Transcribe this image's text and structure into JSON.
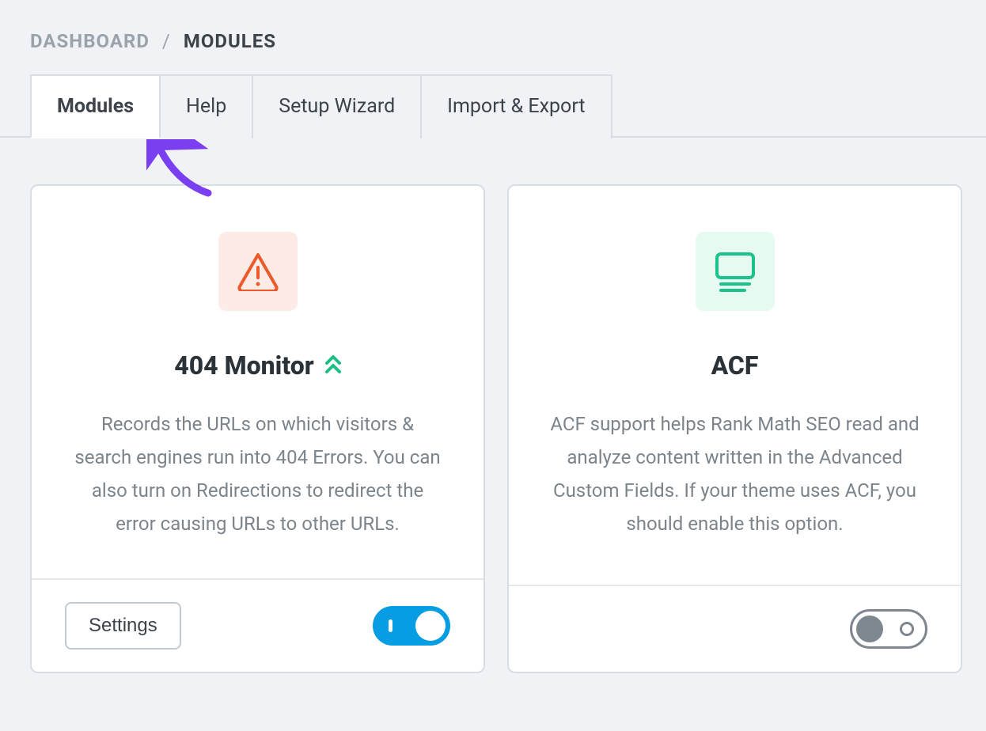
{
  "breadcrumb": {
    "root": "DASHBOARD",
    "current": "MODULES"
  },
  "tabs": {
    "modules": "Modules",
    "help": "Help",
    "setup_wizard": "Setup Wizard",
    "import_export": "Import & Export",
    "active": "modules"
  },
  "cards": {
    "monitor_404": {
      "title": "404 Monitor",
      "desc": "Records the URLs on which visitors & search engines run into 404 Errors. You can also turn on Redirections to redirect the error causing URLs to other URLs.",
      "settings_label": "Settings",
      "toggle": "on",
      "icon": "alert-triangle-icon",
      "accent": "#eb5a2a",
      "badge_icon": "double-chevron-up-icon"
    },
    "acf": {
      "title": "ACF",
      "desc": "ACF support helps Rank Math SEO read and analyze content written in the Advanced Custom Fields. If your theme uses ACF, you should enable this option.",
      "toggle": "off",
      "icon": "screen-lines-icon",
      "accent": "#1bc28c"
    }
  },
  "colors": {
    "arrow": "#7b3ff2"
  }
}
